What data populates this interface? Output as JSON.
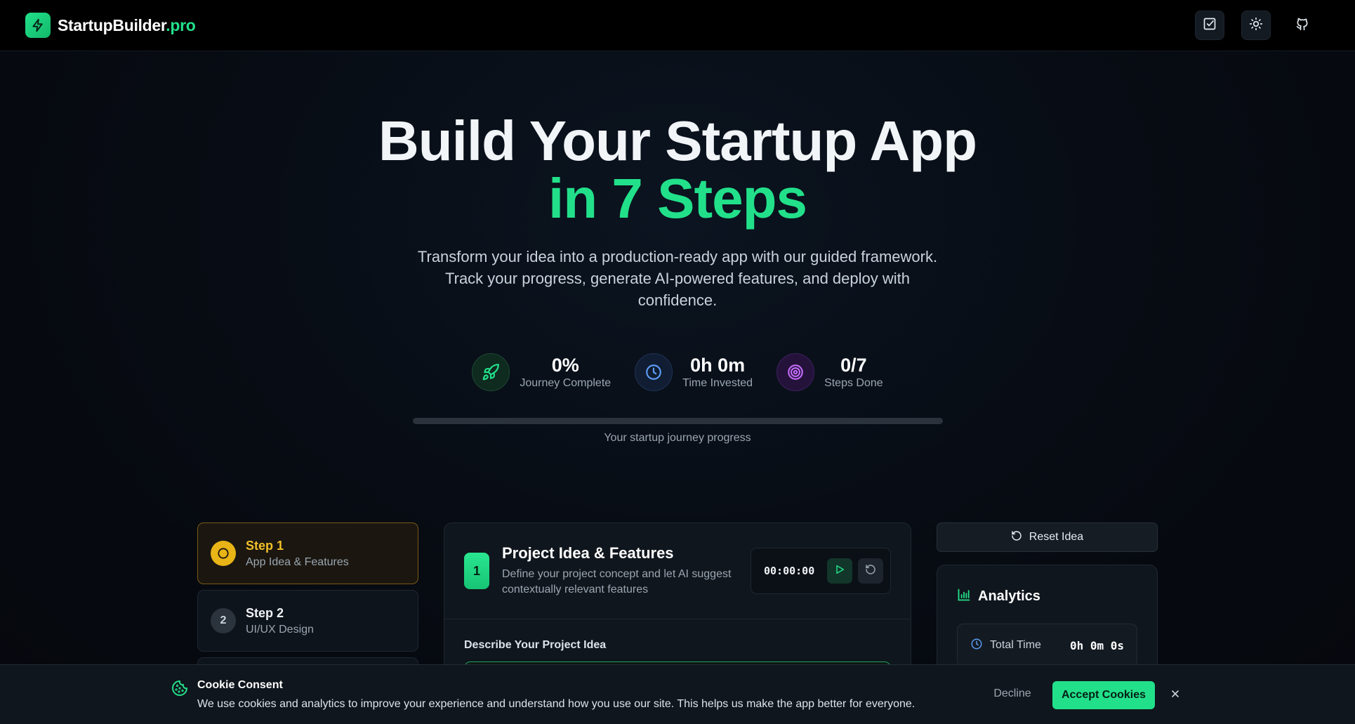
{
  "header": {
    "brand_name": "StartupBuilder",
    "brand_tld": ".pro",
    "icons": [
      "zap-icon",
      "checklist-icon",
      "sun-icon",
      "github-icon"
    ]
  },
  "hero": {
    "title_line1": "Build Your Startup App",
    "title_line2": "in 7 Steps",
    "subtitle": "Transform your idea into a production-ready app with our guided framework. Track your progress, generate AI-powered features, and deploy with confidence."
  },
  "stats": [
    {
      "value": "0%",
      "label": "Journey Complete",
      "icon": "rocket-icon"
    },
    {
      "value": "0h 0m",
      "label": "Time Invested",
      "icon": "clock-icon"
    },
    {
      "value": "0/7",
      "label": "Steps Done",
      "icon": "target-icon"
    }
  ],
  "progress": {
    "percent": 0,
    "caption": "Your startup journey progress"
  },
  "steps": [
    {
      "badge": "",
      "title": "Step 1",
      "subtitle": "App Idea & Features",
      "state": "active"
    },
    {
      "badge": "2",
      "title": "Step 2",
      "subtitle": "UI/UX Design",
      "state": "pending"
    }
  ],
  "panel": {
    "number": "1",
    "title": "Project Idea & Features",
    "description": "Define your project concept and let AI suggest contextually relevant features",
    "timer": "00:00:00",
    "field_label": "Describe Your Project Idea"
  },
  "sidebar": {
    "reset_label": "Reset Idea",
    "analytics_title": "Analytics",
    "total_time_label": "Total Time",
    "total_time_value": "0h 0m 0s"
  },
  "cookie": {
    "title": "Cookie Consent",
    "text": "We use cookies and analytics to improve your experience and understand how you use our site. This helps us make the app better for everyone.",
    "decline_label": "Decline",
    "accept_label": "Accept Cookies"
  },
  "colors": {
    "accent": "#22e08a",
    "active_step": "#e9b416",
    "background": "#070b12"
  }
}
